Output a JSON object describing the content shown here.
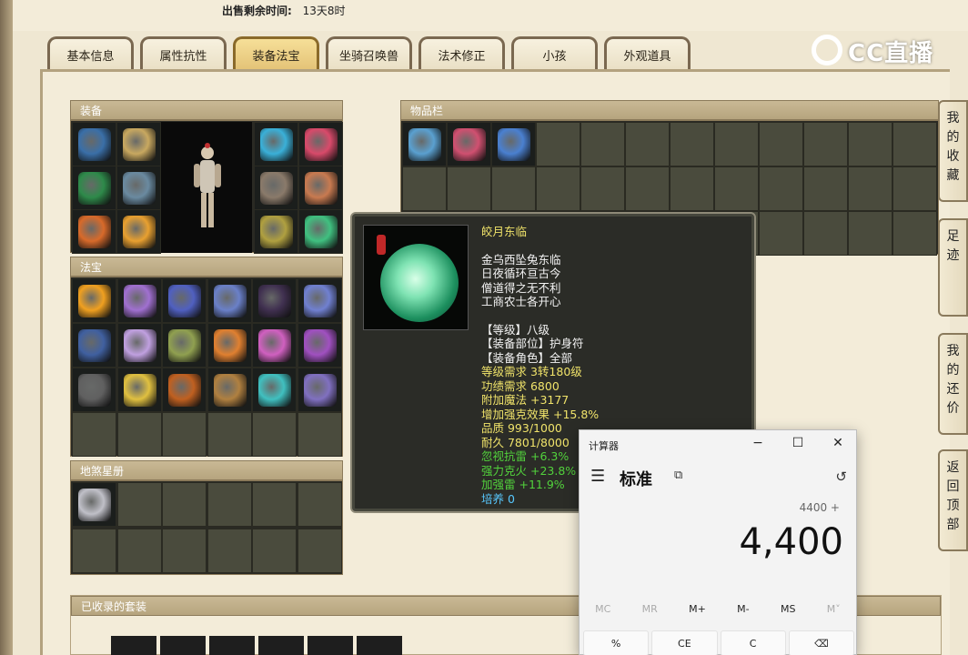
{
  "sale": {
    "label": "出售剩余时间:",
    "value": "13天8时"
  },
  "tabs": [
    {
      "label": "基本信息",
      "active": false
    },
    {
      "label": "属性抗性",
      "active": false
    },
    {
      "label": "装备法宝",
      "active": true
    },
    {
      "label": "坐骑召唤兽",
      "active": false
    },
    {
      "label": "法术修正",
      "active": false
    },
    {
      "label": "小孩",
      "active": false
    },
    {
      "label": "外观道具",
      "active": false
    }
  ],
  "logo": {
    "text": "CC直播"
  },
  "sections": {
    "equipment": "装备",
    "treasure": "法宝",
    "star_book": "地煞星册",
    "inventory": "物品栏",
    "collected_sets": "已收录的套装"
  },
  "item_icon_colors": {
    "equip_left": [
      "#3a6fa8",
      "#c8a860",
      "#2e8a4a",
      "#6a8aa0",
      "#d86a2a",
      "#e8a030"
    ],
    "equip_right": [
      "#3ab0d8",
      "#d84a6a",
      "#8a7a6a",
      "#c87a50",
      "#b0a040",
      "#40c080"
    ],
    "treasure": [
      "#f0a020",
      "#a070d0",
      "#5060c0",
      "#6a80c8",
      "#403050",
      "#7080d0",
      "#4060a0",
      "#c0a0e0",
      "#90a050",
      "#e08030",
      "#d060c0",
      "#a050c0",
      "#606060",
      "#e0c040",
      "#c06020",
      "#b08040",
      "#40c0c0",
      "#8070c0"
    ],
    "inventory": [
      "#5aa0d0",
      "#d05070",
      "#4a80d0"
    ],
    "star_book": [
      "#c0c0c8"
    ]
  },
  "tooltip": {
    "name": "皎月东临",
    "poem": [
      "金乌西坠兔东临",
      "日夜循环亘古今",
      "僧道得之无不利",
      "工商农士各开心"
    ],
    "stats": [
      {
        "text": "【等级】八级",
        "color": "white"
      },
      {
        "text": "【装备部位】护身符",
        "color": "white"
      },
      {
        "text": "【装备角色】全部",
        "color": "white"
      },
      {
        "text": "等级需求 3转180级",
        "color": "yellow"
      },
      {
        "text": "功绩需求 6800",
        "color": "yellow"
      },
      {
        "text": "附加魔法 +3177",
        "color": "yellow"
      },
      {
        "text": "增加强克效果 +15.8%",
        "color": "yellow"
      },
      {
        "text": "品质 993/1000",
        "color": "yellow"
      },
      {
        "text": "耐久 7801/8000",
        "color": "yellow"
      },
      {
        "text": "忽视抗雷 +6.3%",
        "color": "green"
      },
      {
        "text": "强力克火 +23.8%",
        "color": "green"
      },
      {
        "text": "加强雷 +11.9%",
        "color": "green"
      },
      {
        "text": "培养 0",
        "color": "cyan"
      }
    ]
  },
  "calculator": {
    "title": "计算器",
    "mode": "标准",
    "expression": "4400 +",
    "display": "4,400",
    "memory": [
      {
        "label": "MC",
        "enabled": false
      },
      {
        "label": "MR",
        "enabled": false
      },
      {
        "label": "M+",
        "enabled": true
      },
      {
        "label": "M-",
        "enabled": true
      },
      {
        "label": "MS",
        "enabled": true
      },
      {
        "label": "M˅",
        "enabled": false
      }
    ],
    "keys": [
      "%",
      "CE",
      "C",
      "⌫"
    ]
  },
  "side_tabs": [
    "我的收藏",
    "足迹",
    "我的还价",
    "返回顶部"
  ]
}
